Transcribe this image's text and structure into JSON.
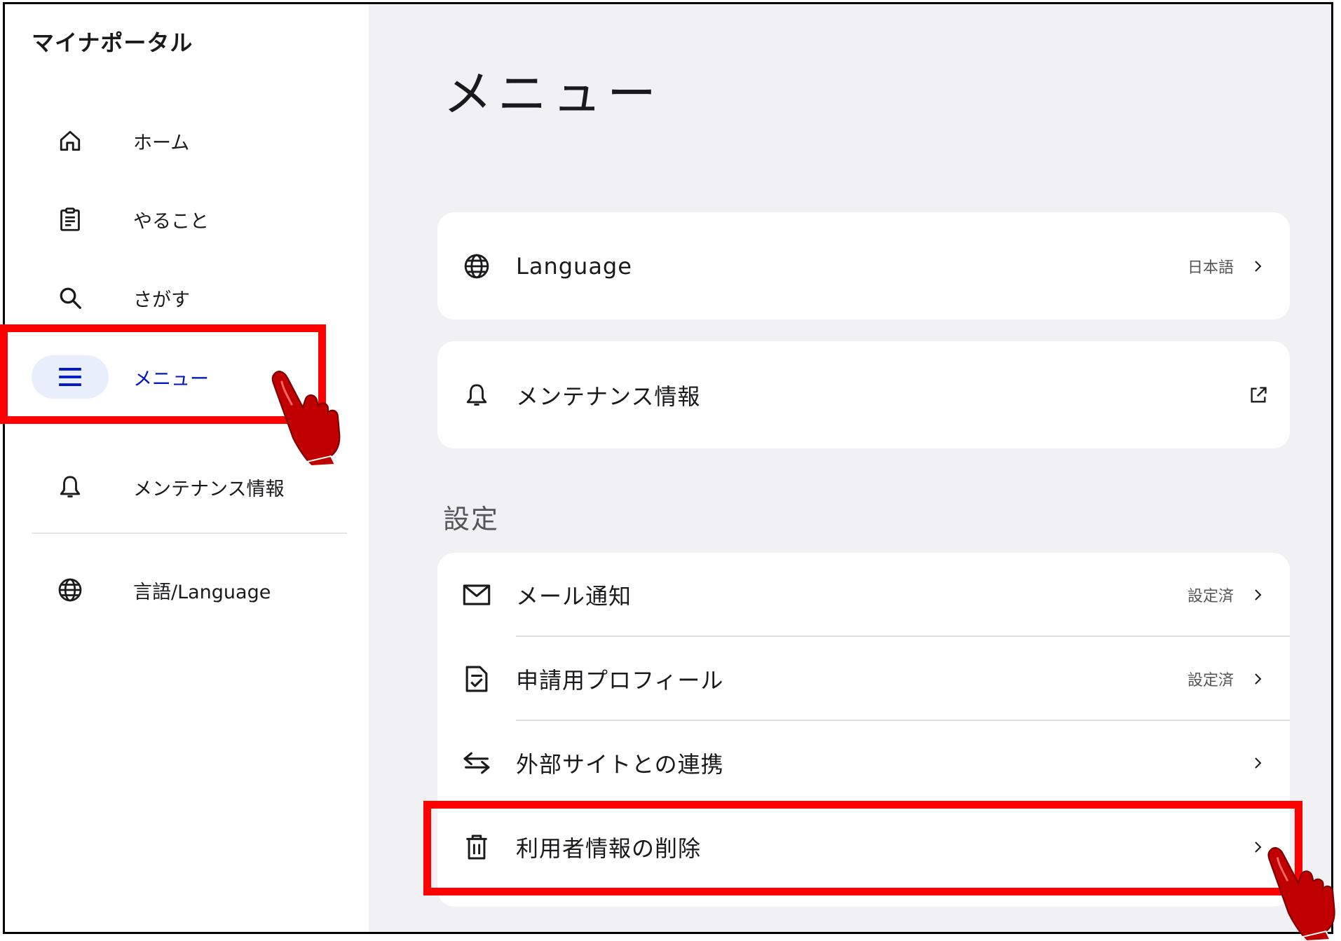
{
  "app_title": "マイナポータル",
  "sidebar": {
    "items": [
      {
        "label": "ホーム",
        "icon": "home-icon"
      },
      {
        "label": "やること",
        "icon": "clipboard-icon"
      },
      {
        "label": "さがす",
        "icon": "search-icon"
      },
      {
        "label": "メニュー",
        "icon": "menu-icon",
        "active": true
      },
      {
        "label": "メンテナンス情報",
        "icon": "bell-icon"
      },
      {
        "label": "言語/Language",
        "icon": "globe-icon"
      }
    ]
  },
  "main": {
    "title": "メニュー",
    "language_row": {
      "label": "Language",
      "value": "日本語",
      "icon": "globe-icon"
    },
    "maintenance_row": {
      "label": "メンテナンス情報",
      "icon": "bell-icon",
      "trailing_icon": "external-link-icon"
    },
    "settings_section": {
      "label": "設定",
      "rows": [
        {
          "label": "メール通知",
          "value": "設定済",
          "icon": "mail-icon"
        },
        {
          "label": "申請用プロフィール",
          "value": "設定済",
          "icon": "document-check-icon"
        },
        {
          "label": "外部サイトとの連携",
          "value": "",
          "icon": "swap-arrows-icon"
        },
        {
          "label": "利用者情報の削除",
          "value": "",
          "icon": "trash-icon"
        }
      ]
    }
  },
  "colors": {
    "accent": "#0017c1",
    "active_bg": "#e8eefc",
    "main_bg": "#f1f1f4",
    "highlight": "#ff0000",
    "hand": "#c00000"
  }
}
